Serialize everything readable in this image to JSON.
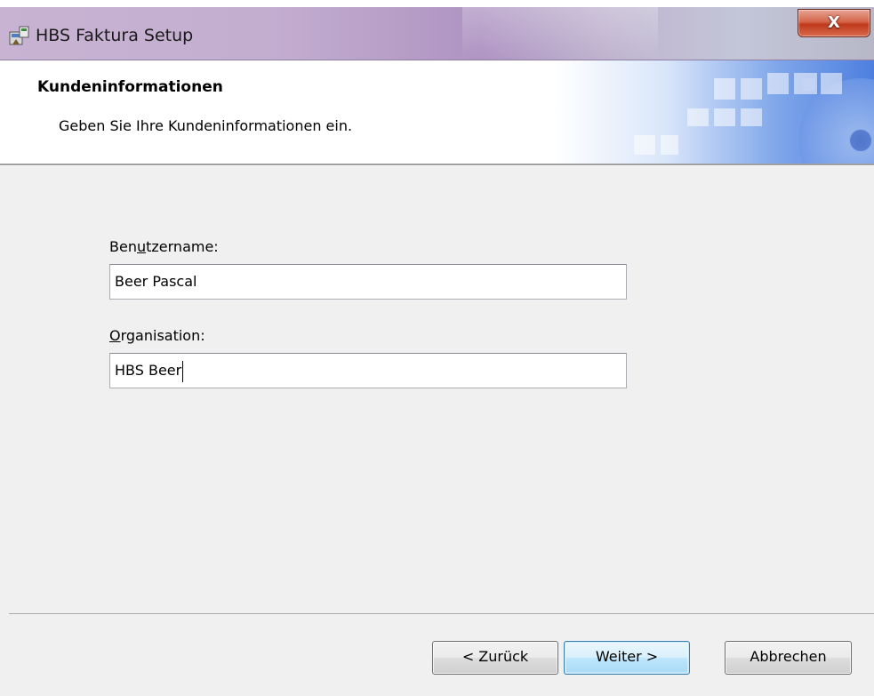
{
  "window": {
    "title": "HBS Faktura Setup",
    "close_glyph": "X"
  },
  "banner": {
    "title": "Kundeninformationen",
    "subtitle": "Geben Sie Ihre Kundeninformationen ein."
  },
  "form": {
    "username_label_before": "Ben",
    "username_label_accel": "u",
    "username_label_after": "tzername:",
    "username_value": "Beer Pascal",
    "org_label_accel": "O",
    "org_label_after": "rganisation:",
    "org_value": "HBS Beer"
  },
  "buttons": {
    "back": "< Zurück",
    "next": "Weiter >",
    "cancel": "Abbrechen"
  },
  "colors": {
    "accent": "#3c7fb1",
    "close": "#c0391b"
  }
}
